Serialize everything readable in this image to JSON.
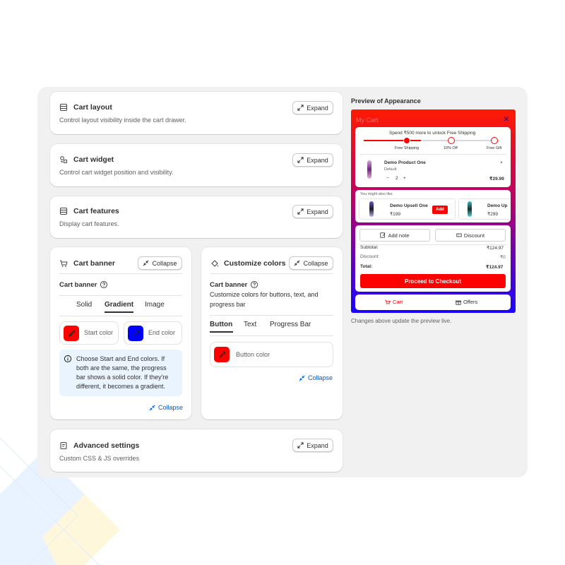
{
  "cards": {
    "cart_layout": {
      "title": "Cart layout",
      "desc": "Control layout visibility inside the cart drawer.",
      "button": "Expand"
    },
    "cart_widget": {
      "title": "Cart widget",
      "desc": "Control cart widget position and visibility.",
      "button": "Expand"
    },
    "cart_features": {
      "title": "Cart features",
      "desc": "Display cart features.",
      "button": "Expand"
    },
    "advanced": {
      "title": "Advanced settings",
      "desc": "Custom CSS & JS overrides",
      "button": "Expand"
    }
  },
  "cart_banner": {
    "title": "Cart banner",
    "button": "Collapse",
    "sub_title": "Cart banner",
    "tabs": [
      "Solid",
      "Gradient",
      "Image"
    ],
    "active_tab": "Gradient",
    "start_label": "Start color",
    "end_label": "End color",
    "start_color": "#ff0000",
    "end_color": "#0000ff",
    "info": [
      "Choose Start and End colors. If",
      "both are the same, the progress",
      "bar shows a solid color. If they're",
      "different, it becomes a gradient."
    ],
    "collapse_link": "Collapse"
  },
  "customize_colors": {
    "title": "Customize colors",
    "button": "Collapse",
    "sub_title": "Cart banner",
    "desc": [
      "Customize colors for buttons, text, and",
      "progress bar"
    ],
    "tabs": [
      "Button",
      "Text",
      "Progress Bar"
    ],
    "active_tab": "Button",
    "button_color_label": "Button color",
    "button_color": "#ff0000",
    "collapse_link": "Collapse"
  },
  "preview": {
    "label": "Preview of Appearance",
    "note": "Changes above update the preview live.",
    "drawer_title": "My Cart",
    "close": "✕",
    "shipping_msg": "Spend ₹500 more to unlock Free Shipping",
    "milestones": [
      "Free Shipping",
      "10% Off",
      "Free Gift"
    ],
    "progress": 0.42,
    "product": {
      "name": "Demo Product One",
      "variant": "Default",
      "qty": "2",
      "price": "₹29.99"
    },
    "upsell_heading": "You might also like",
    "upsells": [
      {
        "name": "Demo Upsell One",
        "price": "₹199",
        "button": "Add"
      },
      {
        "name": "Demo Up",
        "price": "₹299"
      }
    ],
    "add_note": "Add note",
    "discount_btn": "Discount",
    "subtotal_label": "Subtotal:",
    "subtotal_value": "₹124.97",
    "discount_label": "Discount:",
    "discount_value": "₹0",
    "total_label": "Total:",
    "total_value": "₹124.97",
    "checkout": "Proceed to Checkout",
    "footer_cart": "Cart",
    "footer_offers": "Offers",
    "accent": "#ff0000"
  }
}
